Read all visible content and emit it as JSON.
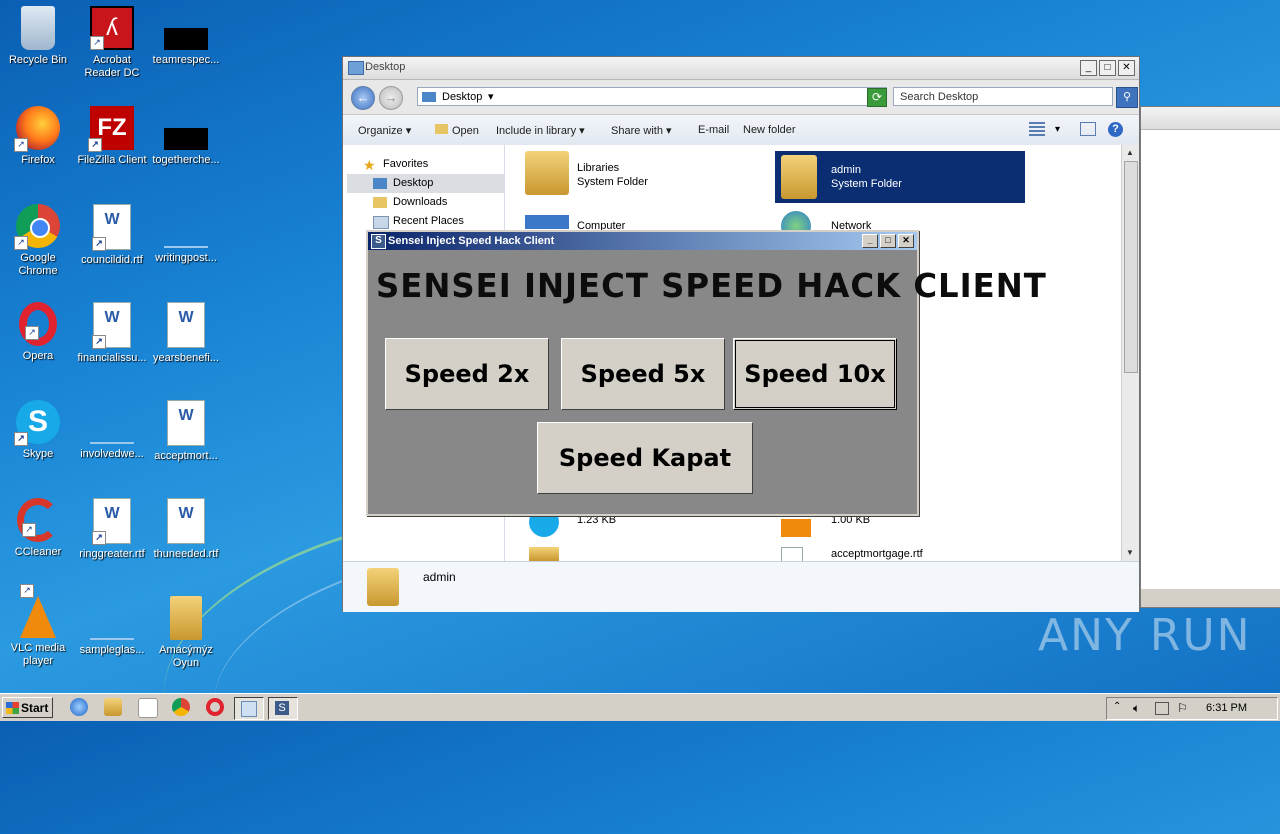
{
  "desktop_icons": [
    {
      "label": "Recycle Bin"
    },
    {
      "label": "Acrobat Reader DC"
    },
    {
      "label": "teamrespec..."
    },
    {
      "label": "Firefox"
    },
    {
      "label": "FileZilla Client"
    },
    {
      "label": "togetherche..."
    },
    {
      "label": "Google Chrome"
    },
    {
      "label": "councildid.rtf"
    },
    {
      "label": "writingpost..."
    },
    {
      "label": "Opera"
    },
    {
      "label": "financialissu..."
    },
    {
      "label": "yearsbenefi..."
    },
    {
      "label": "Skype"
    },
    {
      "label": "involvedwe..."
    },
    {
      "label": "acceptmort..."
    },
    {
      "label": "CCleaner"
    },
    {
      "label": "ringgreater.rtf"
    },
    {
      "label": "thuneeded.rtf"
    },
    {
      "label": "VLC media player"
    },
    {
      "label": "sampleglas..."
    },
    {
      "label": "Amacýmýz Oyun"
    }
  ],
  "explorer": {
    "title": "Desktop",
    "address": "Desktop",
    "search_placeholder": "Search Desktop",
    "toolbar": {
      "organize": "Organize",
      "open": "Open",
      "include": "Include in library",
      "share": "Share with",
      "email": "E-mail",
      "new_folder": "New folder"
    },
    "nav": [
      {
        "label": "Favorites"
      },
      {
        "label": "Desktop"
      },
      {
        "label": "Downloads"
      },
      {
        "label": "Recent Places"
      }
    ],
    "files": [
      {
        "name": "Libraries",
        "sub": "System Folder"
      },
      {
        "name": "admin",
        "sub": "System Folder"
      },
      {
        "name": "Computer",
        "sub": ""
      },
      {
        "name": "Network",
        "sub": ""
      },
      {
        "name": "",
        "sub": "1.23 KB"
      },
      {
        "name": "",
        "sub": "1.00 KB"
      },
      {
        "name": "acceptmortgage.rtf",
        "sub": ""
      }
    ],
    "details_name": "admin"
  },
  "dialog": {
    "title": "Sensei Inject Speed Hack Client",
    "headline": "SENSEI INJECT SPEED HACK CLIENT",
    "buttons": {
      "speed2": "Speed 2x",
      "speed5": "Speed 5x",
      "speed10": "Speed 10x",
      "kapat": "Speed Kapat"
    }
  },
  "taskbar": {
    "start": "Start",
    "clock": "6:31 PM"
  },
  "watermark": "ANY RUN"
}
